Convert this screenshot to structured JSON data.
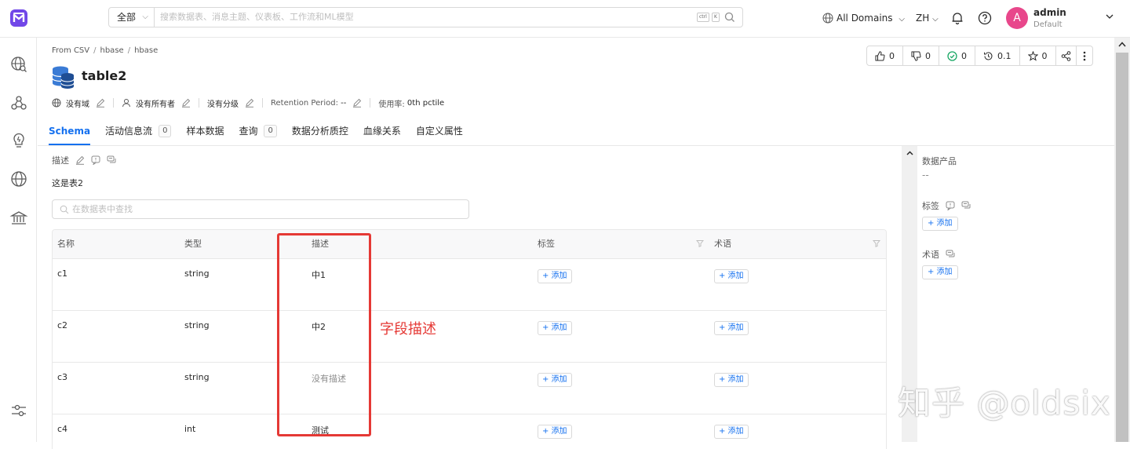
{
  "topbar": {
    "search_scope": "全部",
    "search_placeholder": "搜索数据表、消息主题、仪表板、工作流和ML模型",
    "kbd_ctrl": "ctrl",
    "kbd_k": "K",
    "domains": "All Domains",
    "language": "ZH",
    "user_initial": "A",
    "user_name": "admin",
    "user_role": "Default"
  },
  "sidebar": {
    "items": [
      "explore-icon",
      "observability-icon",
      "insights-icon",
      "domains-icon",
      "governance-icon",
      "settings-icon"
    ]
  },
  "breadcrumb": [
    "From CSV",
    "hbase",
    "hbase"
  ],
  "entity": {
    "title": "table2",
    "domain": "没有域",
    "owner": "没有所有者",
    "tier": "没有分级",
    "retention_label": "Retention Period:",
    "retention_value": "--",
    "usage_label": "使用率:",
    "usage_value": "0th pctile"
  },
  "stats": {
    "up_votes": "0",
    "down_votes": "0",
    "tasks": "0",
    "version": "0.1",
    "stars": "0"
  },
  "tabs": [
    {
      "label": "Schema"
    },
    {
      "label": "活动信息流",
      "count": "0"
    },
    {
      "label": "样本数据"
    },
    {
      "label": "查询",
      "count": "0"
    },
    {
      "label": "数据分析质控"
    },
    {
      "label": "血缘关系"
    },
    {
      "label": "自定义属性"
    }
  ],
  "description": {
    "label": "描述",
    "text": "这是表2"
  },
  "column_search_placeholder": "在数据表中查找",
  "table": {
    "headers": [
      "名称",
      "类型",
      "描述",
      "标签",
      "术语"
    ],
    "add_label": "+ 添加",
    "rows": [
      {
        "name": "c1",
        "type": "string",
        "description": "中1"
      },
      {
        "name": "c2",
        "type": "string",
        "description": "中2"
      },
      {
        "name": "c3",
        "type": "string",
        "description": "没有描述"
      },
      {
        "name": "c4",
        "type": "int",
        "description": "测试"
      }
    ]
  },
  "annotation": "字段描述",
  "right_panel": {
    "data_products_label": "数据产品",
    "data_products_value": "--",
    "tags_label": "标签",
    "glossary_label": "术语",
    "add_label": "+ 添加"
  },
  "watermark": "知乎 @oldsix",
  "colors": {
    "accent": "#1470ef",
    "highlight": "#e53935",
    "avatar": "#e8478b",
    "logo": "#7147e8"
  }
}
